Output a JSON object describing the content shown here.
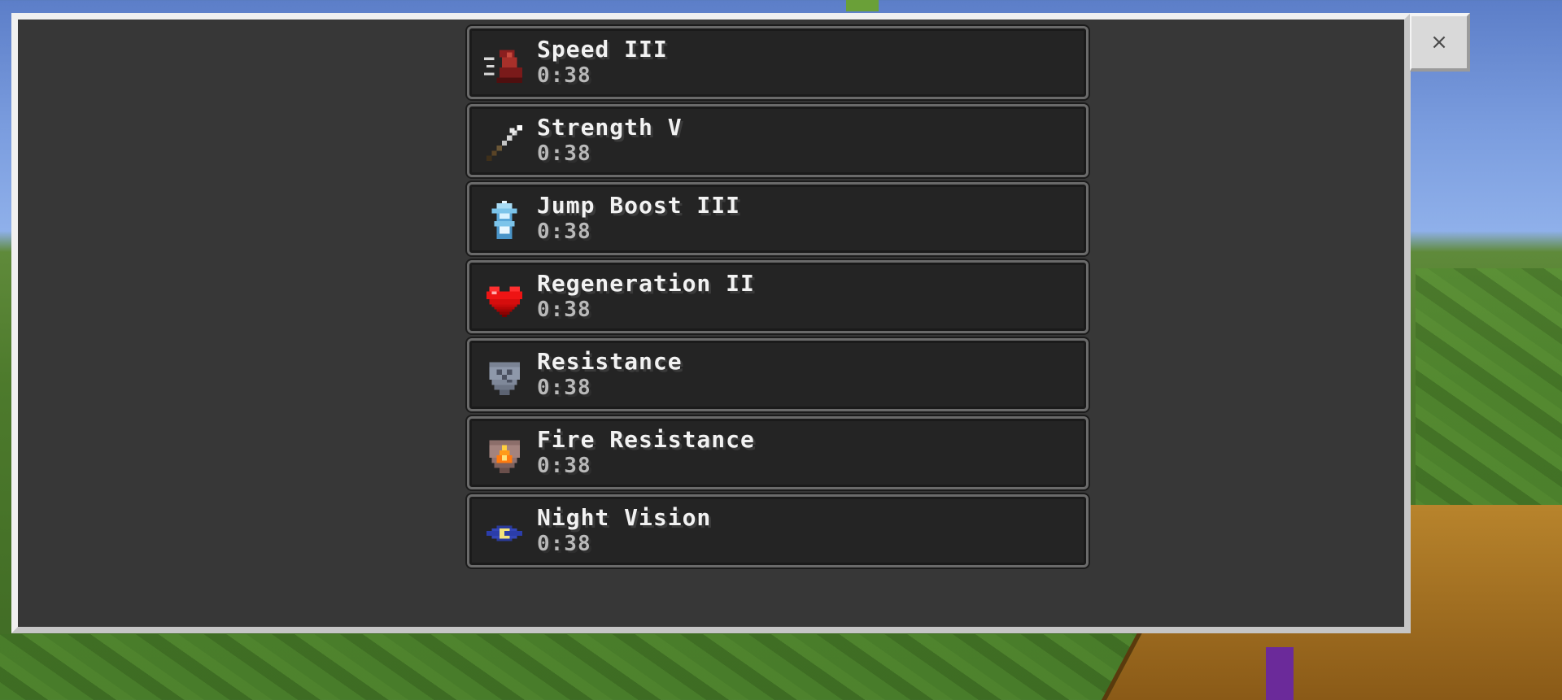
{
  "close_button": {
    "glyph": "×"
  },
  "effects": [
    {
      "name": "Speed III",
      "duration": "0:38",
      "icon": "speed-icon"
    },
    {
      "name": "Strength V",
      "duration": "0:38",
      "icon": "strength-icon"
    },
    {
      "name": "Jump Boost III",
      "duration": "0:38",
      "icon": "jump-boost-icon"
    },
    {
      "name": "Regeneration II",
      "duration": "0:38",
      "icon": "regeneration-icon"
    },
    {
      "name": "Resistance",
      "duration": "0:38",
      "icon": "resistance-icon"
    },
    {
      "name": "Fire Resistance",
      "duration": "0:38",
      "icon": "fire-resistance-icon"
    },
    {
      "name": "Night Vision",
      "duration": "0:38",
      "icon": "night-vision-icon"
    }
  ],
  "colors": {
    "panel": "#373737",
    "row": "#242424",
    "text": "#f2f2f2",
    "duration_text": "#b9b9b9"
  }
}
